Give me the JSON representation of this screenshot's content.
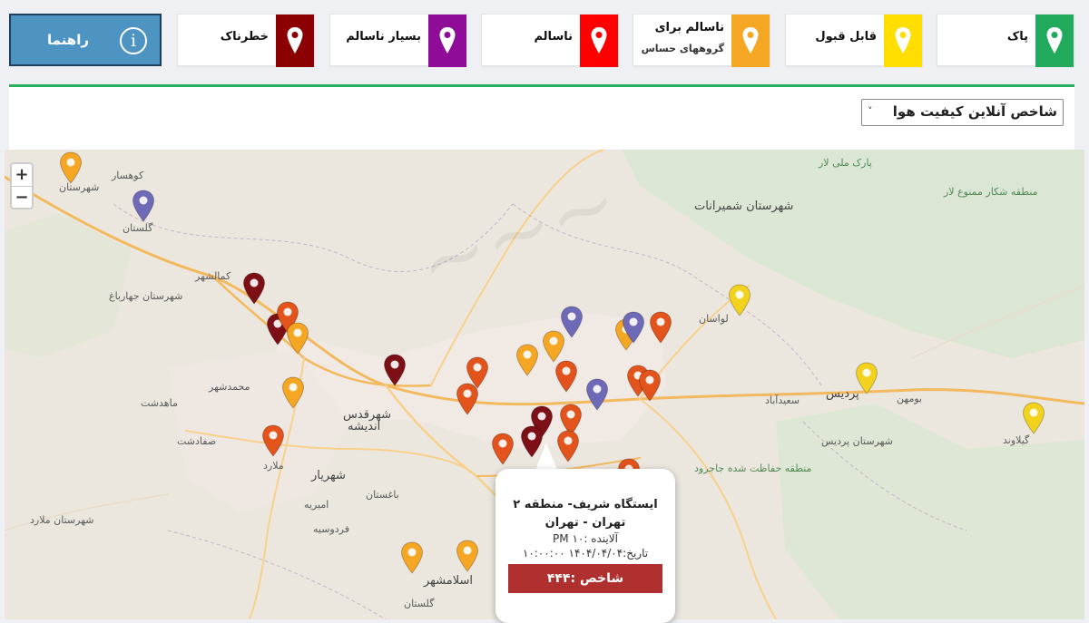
{
  "legend": [
    {
      "label": "پاک",
      "sub": "",
      "color": "#21a95c"
    },
    {
      "label": "قابل قبول",
      "sub": "",
      "color": "#ffde00"
    },
    {
      "label": "ناسالم برای",
      "sub": "گروههای حساس",
      "color": "#f5a623"
    },
    {
      "label": "ناسالم",
      "sub": "",
      "color": "#ff0000"
    },
    {
      "label": "بسیار ناسالم",
      "sub": "",
      "color": "#8e0c98"
    },
    {
      "label": "خطرناک",
      "sub": "",
      "color": "#8b0000"
    }
  ],
  "guide": {
    "label": "راهنما",
    "icon": "info-icon"
  },
  "panel": {
    "select_value": "شاخص آنلاین کیفیت هوا"
  },
  "zoom": {
    "in": "+",
    "out": "−"
  },
  "map_labels": [
    {
      "text": "کوهسار"
    },
    {
      "text": "شهرستان"
    },
    {
      "text": "گلستان"
    },
    {
      "text": "کمالشهر"
    },
    {
      "text": "شهرستان جهارباغ"
    },
    {
      "text": "محمدشهر"
    },
    {
      "text": "ماهدشت"
    },
    {
      "text": "اندیشه"
    },
    {
      "text": "ملارد"
    },
    {
      "text": "شهریار"
    },
    {
      "text": "باغستان"
    },
    {
      "text": "شهرقدس"
    },
    {
      "text": "اسلامشهر"
    },
    {
      "text": "گلستان"
    },
    {
      "text": "شهرستان شمیرانات"
    },
    {
      "text": "لواسان"
    },
    {
      "text": "پردیس"
    },
    {
      "text": "شهرستان پردیس"
    },
    {
      "text": "منطقه حفاظت شده جاجرود"
    },
    {
      "text": "منطقه شکار ممنوع لار"
    },
    {
      "text": "پارک ملی لار"
    },
    {
      "text": "بومهن"
    },
    {
      "text": "سعیدآباد"
    },
    {
      "text": "صفادشت"
    },
    {
      "text": "گیلاوند"
    },
    {
      "text": "شهرستان ملارد"
    },
    {
      "text": "فردوسیه"
    },
    {
      "text": "امیریه"
    }
  ],
  "markers": [
    {
      "level": "unhealthy_sensitive"
    },
    {
      "level": "very_unhealthy"
    },
    {
      "level": "hazardous"
    },
    {
      "level": "hazardous"
    },
    {
      "level": "unhealthy"
    },
    {
      "level": "unhealthy_sensitive"
    },
    {
      "level": "unhealthy_sensitive"
    },
    {
      "level": "unhealthy"
    },
    {
      "level": "unhealthy"
    },
    {
      "level": "hazardous"
    },
    {
      "level": "unhealthy"
    },
    {
      "level": "unhealthy"
    },
    {
      "level": "unhealthy_sensitive"
    },
    {
      "level": "unhealthy_sensitive"
    },
    {
      "level": "very_unhealthy"
    },
    {
      "level": "unhealthy"
    },
    {
      "level": "very_unhealthy"
    },
    {
      "level": "unhealthy_sensitive"
    },
    {
      "level": "very_unhealthy"
    },
    {
      "level": "unhealthy"
    },
    {
      "level": "unhealthy"
    },
    {
      "level": "unhealthy"
    },
    {
      "level": "unhealthy"
    },
    {
      "level": "hazardous"
    },
    {
      "level": "hazardous"
    },
    {
      "level": "unhealthy"
    },
    {
      "level": "unhealthy"
    },
    {
      "level": "acceptable"
    },
    {
      "level": "acceptable"
    },
    {
      "level": "acceptable"
    },
    {
      "level": "unhealthy_sensitive"
    },
    {
      "level": "unhealthy_sensitive"
    }
  ],
  "popup": {
    "station": "ایستگاه شریف- منطقه ۲",
    "city": "تهران - تهران",
    "pollutant": "آلاینده :PM ۱۰",
    "datetime": "تاریخ:۱۴۰۴/۰۴/۰۴ ۱۰:۰۰:۰۰",
    "index": "شاخص :۴۴۴",
    "index_color": "#b03030"
  },
  "level_colors": {
    "good": "#21a95c",
    "acceptable": "#f2d21c",
    "unhealthy_sensitive": "#f5a623",
    "unhealthy": "#e2541b",
    "very_unhealthy": "#6f6ab8",
    "hazardous": "#7d0f16"
  }
}
